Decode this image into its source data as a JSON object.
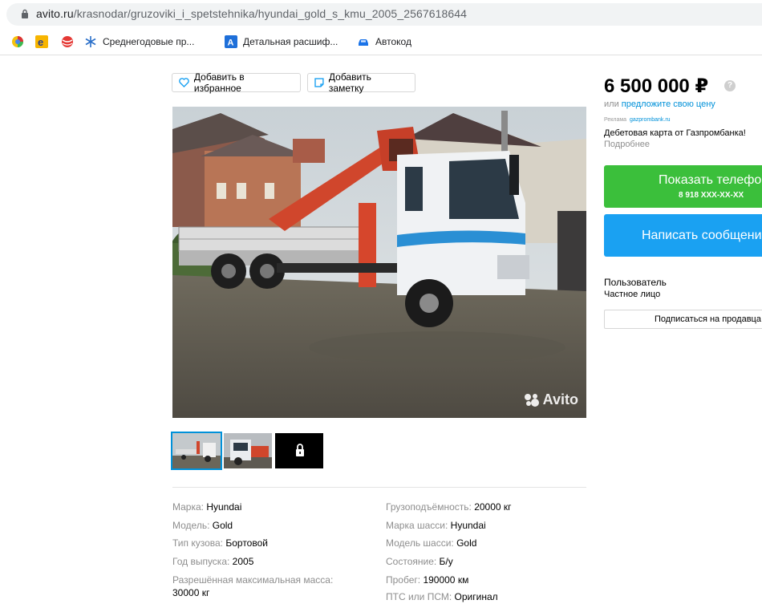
{
  "browser": {
    "url_host": "avito.ru",
    "url_path": "/krasnodar/gruzoviki_i_spetstehnika/hyundai_gold_s_kmu_2005_2567618644",
    "bookmarks": [
      {
        "label": "",
        "icon": "colorful-swirl-icon"
      },
      {
        "label": "",
        "icon": "orange-e-icon"
      },
      {
        "label": "",
        "icon": "red-ball-icon"
      },
      {
        "label": "Среднегодовые пр...",
        "icon": "snowflake-icon"
      },
      {
        "label": "Детальная расшиф...",
        "icon": "blue-a-icon"
      },
      {
        "label": "Автокод",
        "icon": "car-icon"
      }
    ]
  },
  "actions": {
    "favorite": "Добавить в избранное",
    "note": "Добавить заметку"
  },
  "gallery": {
    "watermark": "Avito",
    "thumbs": [
      "thumb-1",
      "thumb-2",
      "locked"
    ]
  },
  "specs_left": [
    {
      "key": "Марка: ",
      "value": "Hyundai"
    },
    {
      "key": "Модель: ",
      "value": "Gold"
    },
    {
      "key": "Тип кузова: ",
      "value": "Бортовой"
    },
    {
      "key": "Год выпуска: ",
      "value": "2005"
    },
    {
      "key": "Разрешённая максимальная масса:",
      "value": "30000 кг"
    }
  ],
  "specs_right": [
    {
      "key": "Грузоподъёмность: ",
      "value": "20000 кг"
    },
    {
      "key": "Марка шасси: ",
      "value": "Hyundai"
    },
    {
      "key": "Модель шасси: ",
      "value": "Gold"
    },
    {
      "key": "Состояние: ",
      "value": "Б/у"
    },
    {
      "key": "Пробег: ",
      "value": "190000 км"
    },
    {
      "key": "ПТС или ПСМ: ",
      "value": "Оригинал"
    }
  ],
  "sidebar": {
    "price": "6 500 000 ₽",
    "price_help": "?",
    "offer_prefix": "или ",
    "offer_link": "предложите свою цену",
    "ad_label": "Реклама",
    "ad_source": "gazprombank.ru",
    "ad_text": "Дебетовая карта от Газпромбанка!",
    "ad_more": "Подробнее",
    "show_phone": "Показать телефон",
    "phone_masked": "8 918 XXX-XX-XX",
    "write_message": "Написать сообщение",
    "seller_name": "Пользователь",
    "seller_type": "Частное лицо",
    "subscribe": "Подписаться на продавца"
  },
  "colors": {
    "green_button": "#3bbf3b",
    "blue_button": "#1aa1f2",
    "link": "#0091d9"
  }
}
